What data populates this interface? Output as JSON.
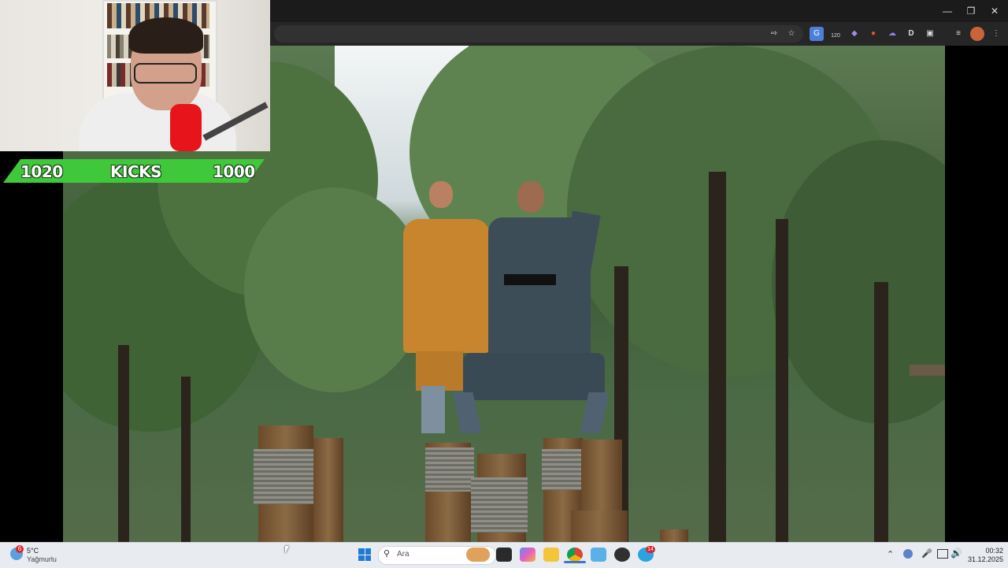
{
  "overlay": {
    "left_count": "1020",
    "label": "KICKS",
    "right_count": "1000"
  },
  "taskbar": {
    "weather": {
      "badge": "6",
      "temp": "5°C",
      "condition": "Yağmurlu"
    },
    "search_placeholder": "Ara",
    "clock": {
      "time": "00:32",
      "date": "31.12.2025"
    },
    "extension_badge": "120",
    "telegram_badge": "14"
  },
  "colors": {
    "banner": "#3fc83a",
    "titlebar": "#1b1b1b",
    "taskbar": "#e8ecf1"
  }
}
